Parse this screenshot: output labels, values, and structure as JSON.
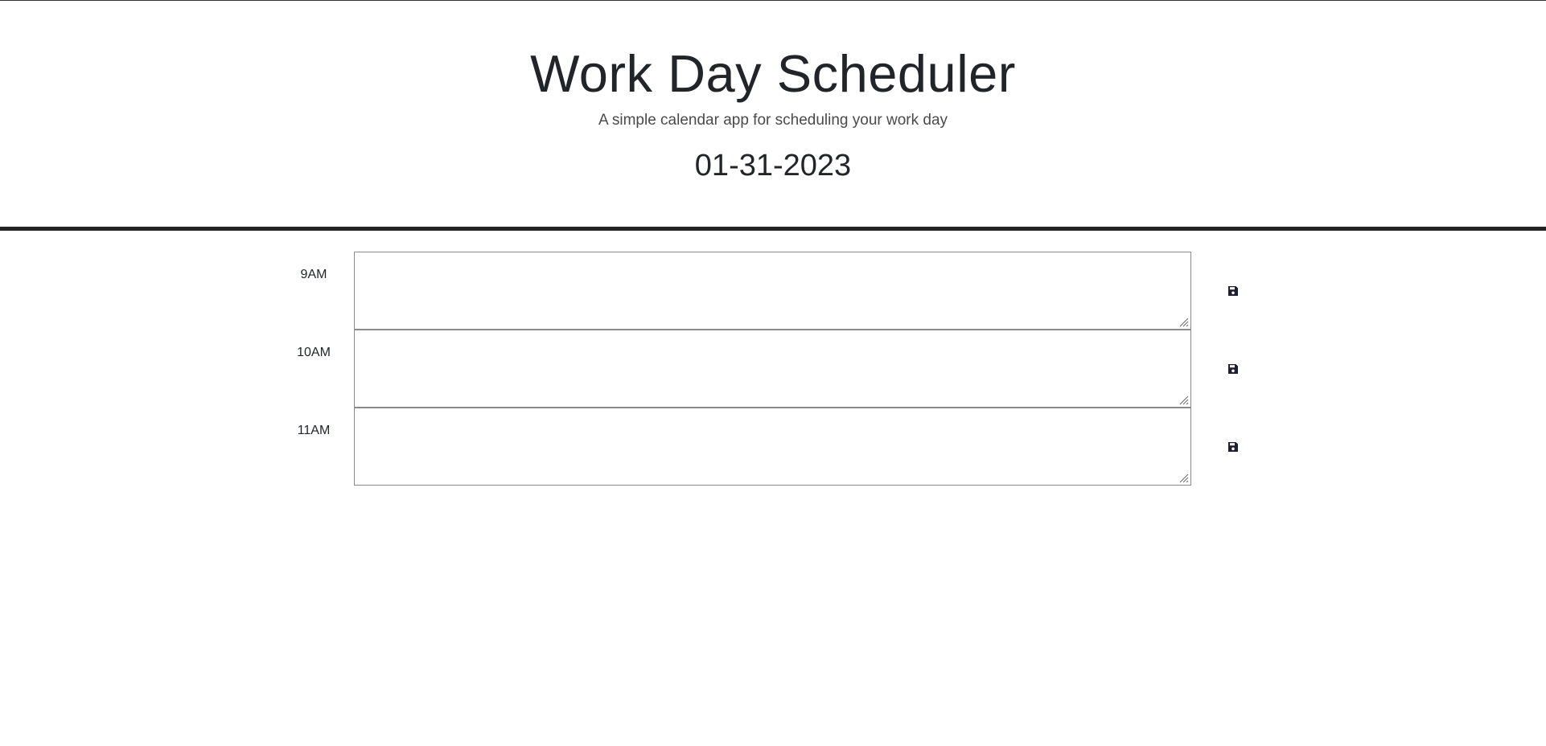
{
  "header": {
    "title": "Work Day Scheduler",
    "subtitle": "A simple calendar app for scheduling your work day",
    "date": "01-31-2023"
  },
  "timeblocks": [
    {
      "hour": "9AM",
      "description": "",
      "save_icon": "save-icon"
    },
    {
      "hour": "10AM",
      "description": "",
      "save_icon": "save-icon"
    },
    {
      "hour": "11AM",
      "description": "",
      "save_icon": "save-icon"
    }
  ],
  "colors": {
    "text": "#212529",
    "header_border": "#222222",
    "textarea_border": "#8a8a8a",
    "icon": "#1f1f33"
  }
}
